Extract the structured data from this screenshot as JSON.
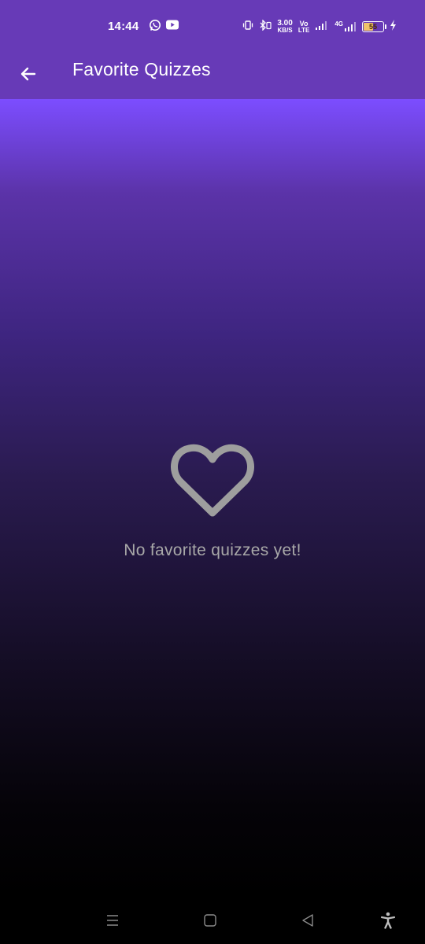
{
  "status_bar": {
    "time": "14:44",
    "app_icons": [
      "whatsapp-icon",
      "youtube-icon"
    ],
    "data_speed": "3.00",
    "data_speed_unit": "KB/S",
    "volte_top": "Vo",
    "volte_bottom": "LTE",
    "network_type": "4G",
    "battery_level": "55",
    "battery_fraction": 0.55,
    "battery_color": "#f0c36a"
  },
  "app_bar": {
    "title": "Favorite Quizzes",
    "back_icon": "arrow-back-icon",
    "color": "#673ab7"
  },
  "empty_state": {
    "icon": "heart-outline-icon",
    "message": "No favorite quizzes yet!",
    "icon_color": "#9e9e9e",
    "text_color": "#a8a8a8"
  },
  "nav_bar": {
    "buttons": [
      "recent-apps-icon",
      "home-icon",
      "back-triangle-icon",
      "accessibility-icon"
    ]
  }
}
